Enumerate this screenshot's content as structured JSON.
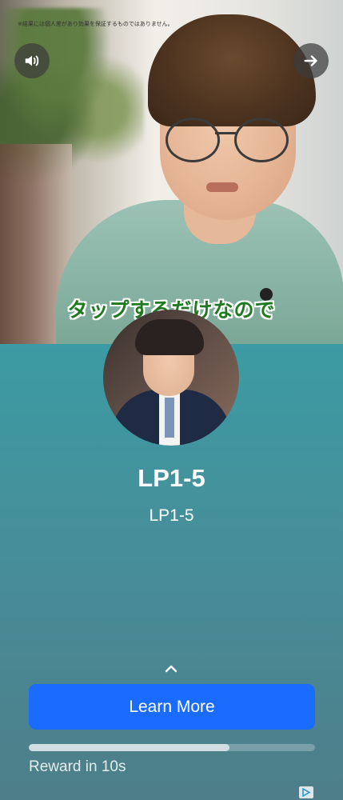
{
  "video": {
    "disclaimer": "※結果には個人差があり効果を保証するものではありません。",
    "subtitle": "タップするだけなので",
    "sound_icon": "speaker-icon",
    "next_icon": "arrow-right-icon"
  },
  "ad": {
    "title": "LP1-5",
    "subtitle": "LP1-5",
    "cta_label": "Learn More",
    "reward_text": "Reward in 10s",
    "reward_progress": 0.7,
    "expand_icon": "chevron-up-icon",
    "adchoices_icon": "adchoices-icon"
  },
  "colors": {
    "cta": "#1a6cff",
    "panel_top": "#3c9ba4",
    "panel_bottom": "#4d7e89",
    "subtitle_text": "#1e7a1e"
  }
}
